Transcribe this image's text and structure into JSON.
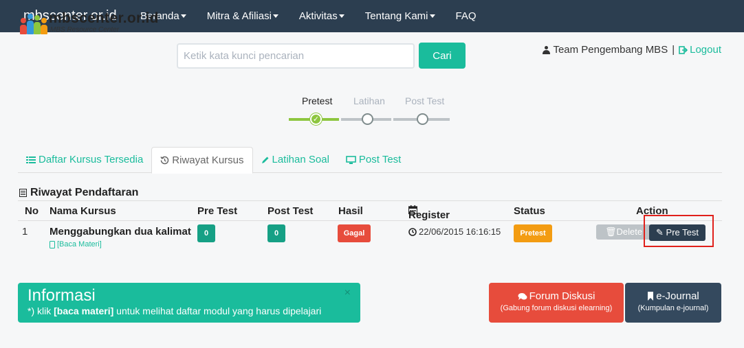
{
  "nav": {
    "brand": "mbscenter.or.id",
    "items": [
      {
        "label": "Beranda",
        "dropdown": true
      },
      {
        "label": "Mitra & Afiliasi",
        "dropdown": true
      },
      {
        "label": "Aktivitas",
        "dropdown": true
      },
      {
        "label": "Tentang Kami",
        "dropdown": true
      },
      {
        "label": "FAQ",
        "dropdown": false
      }
    ]
  },
  "logo": {
    "main": "mbscenter.or.id",
    "sub": "MBS Resource Center"
  },
  "search": {
    "placeholder": "Ketik kata kunci pencarian",
    "button": "Cari"
  },
  "user": {
    "name": "Team Pengembang MBS",
    "separator": "|",
    "logout": "Logout"
  },
  "progress": {
    "steps": [
      {
        "label": "Pretest",
        "state": "done"
      },
      {
        "label": "Latihan",
        "state": "pending"
      },
      {
        "label": "Post Test",
        "state": "pending"
      }
    ]
  },
  "tabs": [
    {
      "label": "Daftar Kursus Tersedia",
      "icon": "list-icon",
      "active": false
    },
    {
      "label": "Riwayat Kursus",
      "icon": "history-icon",
      "active": true
    },
    {
      "label": "Latihan Soal",
      "icon": "pencil-icon",
      "active": false
    },
    {
      "label": "Post Test",
      "icon": "monitor-icon",
      "active": false
    }
  ],
  "section": {
    "title": "Riwayat Pendaftaran"
  },
  "table": {
    "headers": {
      "no": "No",
      "name": "Nama Kursus",
      "pretest": "Pre Test",
      "posttest": "Post Test",
      "hasil": "Hasil",
      "register": "Register",
      "status": "Status",
      "action": "Action"
    },
    "rows": [
      {
        "no": "1",
        "name": "Menggabungkan dua kalimat",
        "link": "[Baca Materi]",
        "pretest": "0",
        "posttest": "0",
        "hasil": "Gagal",
        "register": "22/06/2015 16:16:15",
        "status": "Pretest",
        "delete": "Delete",
        "action": "Pre Test"
      }
    ]
  },
  "info": {
    "title": "Informasi",
    "body_prefix": "*) klik ",
    "body_bold": "[baca materi]",
    "body_suffix": " untuk melihat daftar modul yang harus dipelajari",
    "close": "×"
  },
  "forum": {
    "title": "Forum Diskusi",
    "subtitle": "(Gabung forum diskusi elearning)"
  },
  "journal": {
    "title": "e-Journal",
    "subtitle": "(Kumpulan e-journal)"
  },
  "colors": {
    "nav": "#2c3e50",
    "accent": "#1abc9c",
    "danger": "#e74c3c",
    "warning": "#f39c12",
    "success": "#8dc63f",
    "highlight": "#e0201b"
  }
}
